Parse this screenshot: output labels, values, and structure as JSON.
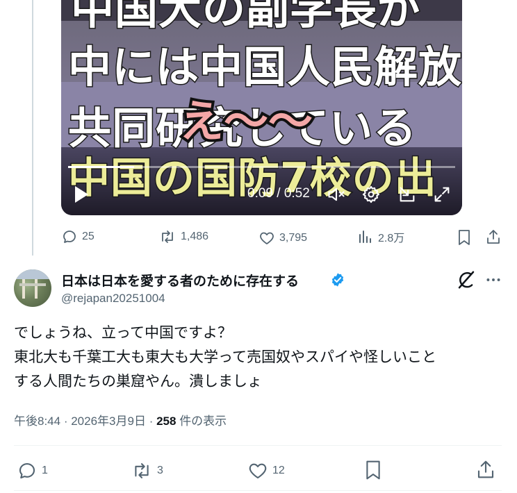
{
  "video": {
    "caption_lines": [
      "中国大の副学長が",
      "中には中国人民解放",
      "共同研究している",
      "中国の国防7校の出"
    ],
    "sticker_text": "え〜〜",
    "time_display": "0:09 / 0:52",
    "progress": 0.17
  },
  "quoted_actions": {
    "reply_count": "25",
    "repost_count": "1,486",
    "like_count": "3,795",
    "views_count": "2.8万"
  },
  "tweet": {
    "display_name": "日本は日本を愛する者のために存在する",
    "handle": "@rejapan20251004",
    "verified": true,
    "text": "でしょうね、立って中国ですよ？\n東北大も千葉工大も東大も大学って売国奴やスパイや怪しいこと\nする人間たちの巣窟やん。潰しましょ",
    "time": "午後8:44",
    "date": "2026年3月9日",
    "views": "258",
    "views_label": "件の表示"
  },
  "tweet_actions": {
    "reply_count": "1",
    "repost_count": "3",
    "like_count": "12"
  },
  "colors": {
    "secondary_text": "#536471",
    "verified_blue": "#1d9bf0",
    "divider": "#eff3f4"
  }
}
